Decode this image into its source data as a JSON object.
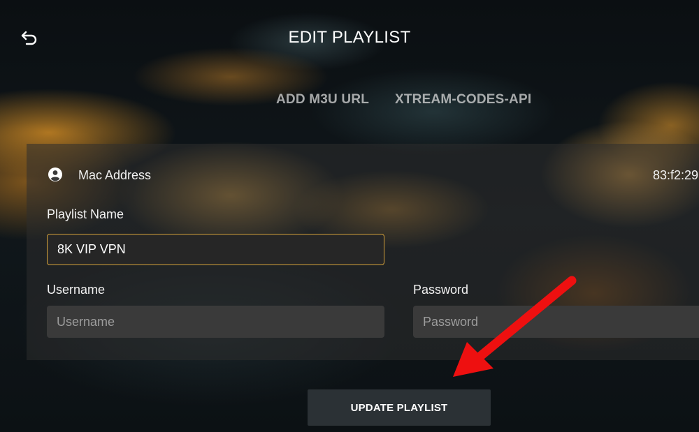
{
  "header": {
    "title": "EDIT PLAYLIST",
    "back_icon": "undo-arrow-icon"
  },
  "tabs": [
    {
      "label": "ADD M3U URL"
    },
    {
      "label": "XTREAM-CODES-API"
    }
  ],
  "device": {
    "icon": "account-circle-icon",
    "mac_label": "Mac Address",
    "mac_value": "83:f2:29"
  },
  "form": {
    "playlist_name_label": "Playlist Name",
    "playlist_name_value": "8K VIP VPN",
    "username_label": "Username",
    "username_placeholder": "Username",
    "password_label": "Password",
    "password_placeholder": "Password"
  },
  "actions": {
    "update_label": "UPDATE PLAYLIST"
  },
  "annotation": {
    "arrow_icon": "red-pointer-arrow-icon",
    "arrow_color": "#ee1010"
  },
  "colors": {
    "focus_border": "#d5a23a",
    "button_bg": "#2b3135"
  }
}
